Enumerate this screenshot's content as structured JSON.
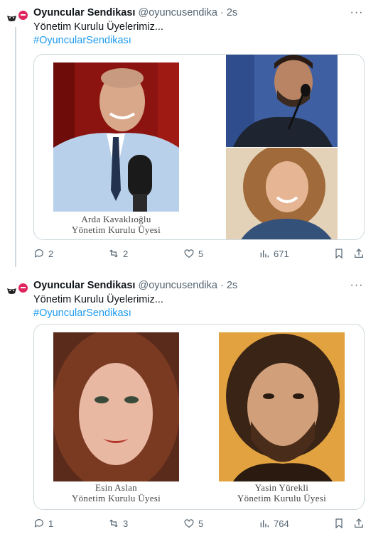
{
  "tweets": [
    {
      "author": {
        "name": "Oyuncular Sendikası",
        "handle": "@oyuncusendika",
        "time": "2s"
      },
      "text": "Yönetim Kurulu Üyelerimiz...",
      "hashtag": "#OyuncularSendikası",
      "media": [
        {
          "caption_name": "Arda Kavaklıoğlu",
          "caption_role": "Yönetim Kurulu Üyesi"
        }
      ],
      "stats": {
        "replies": "2",
        "retweets": "2",
        "likes": "5",
        "views": "671"
      }
    },
    {
      "author": {
        "name": "Oyuncular Sendikası",
        "handle": "@oyuncusendika",
        "time": "2s"
      },
      "text": "Yönetim Kurulu Üyelerimiz...",
      "hashtag": "#OyuncularSendikası",
      "media": [
        {
          "caption_name": "Esin Aslan",
          "caption_role": "Yönetim Kurulu Üyesi"
        },
        {
          "caption_name": "Yasin Yürekli",
          "caption_role": "Yönetim Kurulu Üyesi"
        }
      ],
      "stats": {
        "replies": "1",
        "retweets": "3",
        "likes": "5",
        "views": "764"
      }
    }
  ],
  "colors": {
    "accent": "#1d9bf0",
    "muted": "#536471",
    "border": "#cfd9de"
  }
}
